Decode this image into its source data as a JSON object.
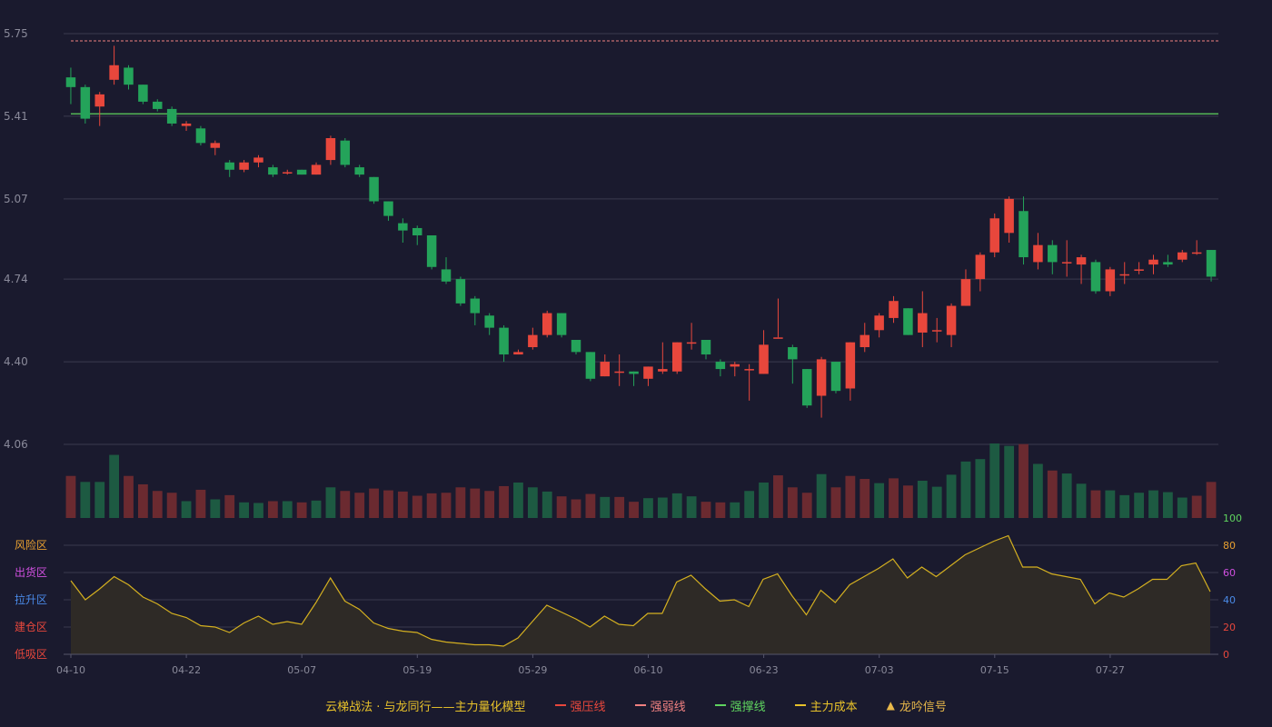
{
  "colors": {
    "background": "#1a1a2e",
    "grid": "#3a3a4e",
    "axis_text": "#8a8a9a",
    "up": "#e8473c",
    "down": "#24a35a",
    "vol_up": "#6b2a30",
    "vol_down": "#1d5a42",
    "strong_pressure": "#e8473c",
    "strong_weak": "#f08080",
    "support": "#5fd45f",
    "main_cost": "#e8c22a",
    "signal": "#e8b84a",
    "osc_line": "#d4b020",
    "osc_fill": "#2e2a26"
  },
  "chart_data": {
    "type": "candlestick",
    "price_axis": {
      "ticks": [
        "5.75",
        "5.41",
        "5.07",
        "4.74",
        "4.40",
        "4.06"
      ],
      "ylim": [
        4.06,
        5.75
      ]
    },
    "x_tick_labels": [
      "04-10",
      "04-22",
      "05-07",
      "05-19",
      "05-29",
      "06-10",
      "06-23",
      "07-03",
      "07-15",
      "07-27"
    ],
    "x_tick_index": [
      0,
      8,
      16,
      24,
      32,
      40,
      48,
      56,
      64,
      72
    ],
    "candles": [
      [
        5.57,
        5.53,
        5.61,
        5.46
      ],
      [
        5.53,
        5.4,
        5.54,
        5.38
      ],
      [
        5.45,
        5.5,
        5.51,
        5.37
      ],
      [
        5.56,
        5.62,
        5.7,
        5.54
      ],
      [
        5.61,
        5.54,
        5.62,
        5.52
      ],
      [
        5.54,
        5.47,
        5.54,
        5.46
      ],
      [
        5.47,
        5.44,
        5.48,
        5.43
      ],
      [
        5.44,
        5.38,
        5.45,
        5.37
      ],
      [
        5.37,
        5.38,
        5.39,
        5.35
      ],
      [
        5.36,
        5.3,
        5.37,
        5.29
      ],
      [
        5.28,
        5.3,
        5.31,
        5.25
      ],
      [
        5.22,
        5.19,
        5.23,
        5.16
      ],
      [
        5.19,
        5.22,
        5.23,
        5.18
      ],
      [
        5.22,
        5.24,
        5.25,
        5.2
      ],
      [
        5.2,
        5.17,
        5.21,
        5.16
      ],
      [
        5.18,
        5.18,
        5.19,
        5.17
      ],
      [
        5.19,
        5.17,
        5.19,
        5.17
      ],
      [
        5.17,
        5.21,
        5.22,
        5.17
      ],
      [
        5.23,
        5.32,
        5.33,
        5.21
      ],
      [
        5.31,
        5.21,
        5.32,
        5.2
      ],
      [
        5.2,
        5.17,
        5.21,
        5.16
      ],
      [
        5.16,
        5.06,
        5.16,
        5.05
      ],
      [
        5.06,
        5.0,
        5.06,
        4.98
      ],
      [
        4.97,
        4.94,
        4.99,
        4.89
      ],
      [
        4.95,
        4.92,
        4.96,
        4.88
      ],
      [
        4.92,
        4.79,
        4.92,
        4.78
      ],
      [
        4.78,
        4.73,
        4.83,
        4.72
      ],
      [
        4.74,
        4.64,
        4.75,
        4.63
      ],
      [
        4.66,
        4.6,
        4.67,
        4.55
      ],
      [
        4.59,
        4.54,
        4.6,
        4.51
      ],
      [
        4.54,
        4.43,
        4.55,
        4.4
      ],
      [
        4.43,
        4.44,
        4.45,
        4.43
      ],
      [
        4.46,
        4.51,
        4.54,
        4.45
      ],
      [
        4.51,
        4.6,
        4.61,
        4.5
      ],
      [
        4.6,
        4.51,
        4.6,
        4.5
      ],
      [
        4.49,
        4.44,
        4.49,
        4.43
      ],
      [
        4.44,
        4.33,
        4.44,
        4.32
      ],
      [
        4.34,
        4.4,
        4.43,
        4.34
      ],
      [
        4.36,
        4.36,
        4.43,
        4.3
      ],
      [
        4.36,
        4.35,
        4.36,
        4.3
      ],
      [
        4.33,
        4.38,
        4.38,
        4.3
      ],
      [
        4.36,
        4.37,
        4.48,
        4.35
      ],
      [
        4.36,
        4.48,
        4.48,
        4.35
      ],
      [
        4.48,
        4.48,
        4.56,
        4.45
      ],
      [
        4.49,
        4.43,
        4.49,
        4.41
      ],
      [
        4.4,
        4.37,
        4.41,
        4.34
      ],
      [
        4.38,
        4.39,
        4.4,
        4.34
      ],
      [
        4.37,
        4.37,
        4.39,
        4.24
      ],
      [
        4.35,
        4.47,
        4.53,
        4.35
      ],
      [
        4.5,
        4.5,
        4.66,
        4.5
      ],
      [
        4.46,
        4.41,
        4.47,
        4.31
      ],
      [
        4.37,
        4.22,
        4.37,
        4.21
      ],
      [
        4.26,
        4.41,
        4.42,
        4.17
      ],
      [
        4.4,
        4.28,
        4.4,
        4.27
      ],
      [
        4.29,
        4.48,
        4.48,
        4.24
      ],
      [
        4.46,
        4.51,
        4.56,
        4.44
      ],
      [
        4.53,
        4.59,
        4.6,
        4.5
      ],
      [
        4.58,
        4.65,
        4.67,
        4.56
      ],
      [
        4.62,
        4.51,
        4.62,
        4.51
      ],
      [
        4.52,
        4.6,
        4.69,
        4.46
      ],
      [
        4.53,
        4.53,
        4.58,
        4.48
      ],
      [
        4.51,
        4.63,
        4.64,
        4.46
      ],
      [
        4.63,
        4.74,
        4.78,
        4.63
      ],
      [
        4.74,
        4.84,
        4.85,
        4.69
      ],
      [
        4.85,
        4.99,
        5.01,
        4.83
      ],
      [
        4.93,
        5.07,
        5.08,
        4.89
      ],
      [
        5.02,
        4.83,
        5.08,
        4.8
      ],
      [
        4.81,
        4.88,
        4.93,
        4.78
      ],
      [
        4.88,
        4.81,
        4.9,
        4.76
      ],
      [
        4.81,
        4.81,
        4.9,
        4.75
      ],
      [
        4.8,
        4.83,
        4.84,
        4.72
      ],
      [
        4.81,
        4.69,
        4.82,
        4.68
      ],
      [
        4.69,
        4.78,
        4.79,
        4.67
      ],
      [
        4.76,
        4.76,
        4.81,
        4.72
      ],
      [
        4.78,
        4.78,
        4.81,
        4.76
      ],
      [
        4.8,
        4.82,
        4.84,
        4.76
      ],
      [
        4.81,
        4.8,
        4.84,
        4.79
      ],
      [
        4.82,
        4.85,
        4.86,
        4.81
      ],
      [
        4.85,
        4.85,
        4.9,
        4.84
      ],
      [
        4.86,
        4.75,
        4.86,
        4.73
      ]
    ],
    "volume": [
      [
        70,
        1
      ],
      [
        60,
        0
      ],
      [
        60,
        0
      ],
      [
        105,
        0
      ],
      [
        70,
        1
      ],
      [
        56,
        1
      ],
      [
        45,
        1
      ],
      [
        42,
        1
      ],
      [
        28,
        0
      ],
      [
        47,
        1
      ],
      [
        31,
        0
      ],
      [
        38,
        1
      ],
      [
        26,
        0
      ],
      [
        25,
        0
      ],
      [
        28,
        1
      ],
      [
        28,
        0
      ],
      [
        26,
        1
      ],
      [
        29,
        0
      ],
      [
        51,
        0
      ],
      [
        45,
        1
      ],
      [
        42,
        1
      ],
      [
        49,
        1
      ],
      [
        46,
        1
      ],
      [
        44,
        1
      ],
      [
        37,
        1
      ],
      [
        41,
        1
      ],
      [
        42,
        1
      ],
      [
        51,
        1
      ],
      [
        49,
        1
      ],
      [
        45,
        1
      ],
      [
        53,
        1
      ],
      [
        59,
        0
      ],
      [
        51,
        0
      ],
      [
        44,
        0
      ],
      [
        36,
        1
      ],
      [
        31,
        1
      ],
      [
        40,
        1
      ],
      [
        35,
        0
      ],
      [
        35,
        1
      ],
      [
        27,
        1
      ],
      [
        33,
        0
      ],
      [
        34,
        0
      ],
      [
        41,
        0
      ],
      [
        36,
        0
      ],
      [
        27,
        1
      ],
      [
        26,
        1
      ],
      [
        26,
        0
      ],
      [
        45,
        0
      ],
      [
        59,
        0
      ],
      [
        71,
        1
      ],
      [
        51,
        1
      ],
      [
        42,
        1
      ],
      [
        73,
        0
      ],
      [
        51,
        1
      ],
      [
        70,
        1
      ],
      [
        65,
        1
      ],
      [
        58,
        0
      ],
      [
        66,
        1
      ],
      [
        54,
        1
      ],
      [
        62,
        0
      ],
      [
        52,
        0
      ],
      [
        72,
        0
      ],
      [
        94,
        0
      ],
      [
        98,
        0
      ],
      [
        124,
        0
      ],
      [
        120,
        0
      ],
      [
        123,
        1
      ],
      [
        90,
        0
      ],
      [
        79,
        1
      ],
      [
        74,
        0
      ],
      [
        57,
        0
      ],
      [
        46,
        1
      ],
      [
        46,
        0
      ],
      [
        38,
        0
      ],
      [
        42,
        0
      ],
      [
        46,
        0
      ],
      [
        43,
        0
      ],
      [
        34,
        0
      ],
      [
        37,
        1
      ],
      [
        60,
        1
      ]
    ],
    "upper_dashed_line": 5.72,
    "support_line": 5.42,
    "oscillator": {
      "ylim": [
        0,
        100
      ],
      "zone_labels": [
        "风险区",
        "出货区",
        "拉升区",
        "建仓区",
        "低吸区"
      ],
      "ticks": [
        "100",
        "80",
        "60",
        "40",
        "20",
        "0"
      ],
      "values": [
        54,
        40,
        48,
        57,
        51,
        42,
        37,
        30,
        27,
        21,
        20,
        16,
        23,
        28,
        22,
        24,
        22,
        38,
        56,
        39,
        33,
        23,
        19,
        17,
        16,
        11,
        9,
        8,
        7,
        7,
        6,
        12,
        24,
        36,
        31,
        26,
        20,
        28,
        22,
        21,
        30,
        30,
        53,
        58,
        48,
        39,
        40,
        35,
        55,
        59,
        43,
        29,
        47,
        38,
        51,
        57,
        63,
        70,
        56,
        64,
        57,
        65,
        73,
        78,
        83,
        87,
        64,
        64,
        59,
        57,
        55,
        37,
        45,
        42,
        48,
        55,
        55,
        65,
        67,
        46
      ]
    }
  },
  "legend": {
    "model_title": "云梯战法 · 与龙同行——主力量化模型",
    "items": [
      "强压线",
      "强弱线",
      "强撑线",
      "主力成本",
      "龙吟信号"
    ]
  }
}
